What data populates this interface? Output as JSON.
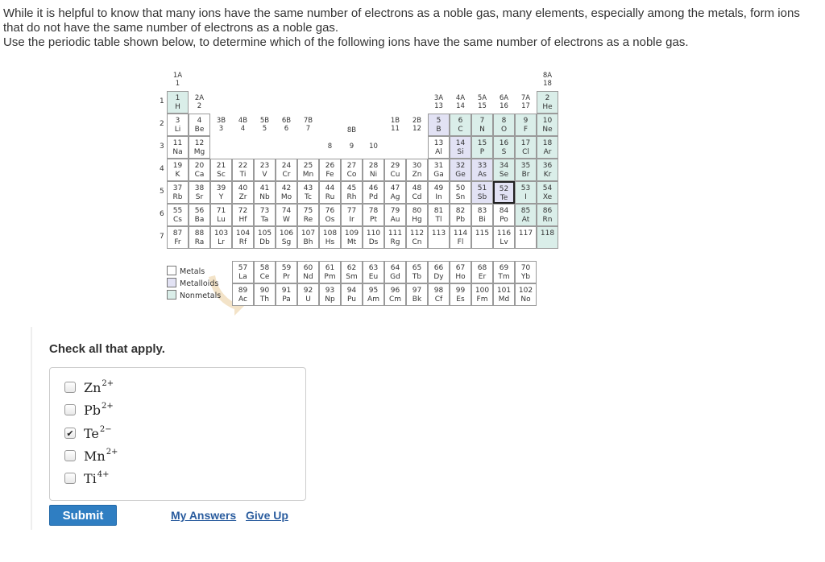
{
  "question": {
    "line1": "While it is helpful to know that many ions have the same number of electrons as a noble gas, many elements, especially among the metals, form ions that do not have the same number of electrons as a noble gas.",
    "line2": "Use the periodic table shown below, to determine which of the following ions have the same number of electrons as a noble gas."
  },
  "periodic_table": {
    "group_labels": {
      "1A": "1A",
      "1": "1",
      "2A": "2A",
      "2": "2",
      "3B": "3B",
      "3": "3",
      "4B": "4B",
      "4": "4",
      "5B": "5B",
      "5": "5",
      "6B": "6B",
      "6": "6",
      "7B": "7B",
      "7": "7",
      "8B": "8B",
      "8": "8",
      "9": "9",
      "10": "10",
      "1B": "1B",
      "11": "11",
      "2B": "2B",
      "12": "12",
      "3A": "3A",
      "13": "13",
      "4A": "4A",
      "14": "14",
      "5A": "5A",
      "15": "15",
      "6A": "6A",
      "16": "16",
      "7A": "7A",
      "17": "17",
      "8A": "8A",
      "18": "18"
    },
    "periods": [
      "1",
      "2",
      "3",
      "4",
      "5",
      "6",
      "7"
    ],
    "elements": [
      {
        "z": "1",
        "s": "H",
        "t": "non"
      },
      {
        "z": "2",
        "s": "He",
        "t": "non"
      },
      {
        "z": "3",
        "s": "Li",
        "t": "met"
      },
      {
        "z": "4",
        "s": "Be",
        "t": "met"
      },
      {
        "z": "5",
        "s": "B",
        "t": "mld"
      },
      {
        "z": "6",
        "s": "C",
        "t": "non"
      },
      {
        "z": "7",
        "s": "N",
        "t": "non"
      },
      {
        "z": "8",
        "s": "O",
        "t": "non"
      },
      {
        "z": "9",
        "s": "F",
        "t": "non"
      },
      {
        "z": "10",
        "s": "Ne",
        "t": "non"
      },
      {
        "z": "11",
        "s": "Na",
        "t": "met"
      },
      {
        "z": "12",
        "s": "Mg",
        "t": "met"
      },
      {
        "z": "13",
        "s": "Al",
        "t": "met"
      },
      {
        "z": "14",
        "s": "Si",
        "t": "mld"
      },
      {
        "z": "15",
        "s": "P",
        "t": "non"
      },
      {
        "z": "16",
        "s": "S",
        "t": "non"
      },
      {
        "z": "17",
        "s": "Cl",
        "t": "non"
      },
      {
        "z": "18",
        "s": "Ar",
        "t": "non"
      },
      {
        "z": "19",
        "s": "K",
        "t": "met"
      },
      {
        "z": "20",
        "s": "Ca",
        "t": "met"
      },
      {
        "z": "21",
        "s": "Sc",
        "t": "met"
      },
      {
        "z": "22",
        "s": "Ti",
        "t": "met"
      },
      {
        "z": "23",
        "s": "V",
        "t": "met"
      },
      {
        "z": "24",
        "s": "Cr",
        "t": "met"
      },
      {
        "z": "25",
        "s": "Mn",
        "t": "met"
      },
      {
        "z": "26",
        "s": "Fe",
        "t": "met"
      },
      {
        "z": "27",
        "s": "Co",
        "t": "met"
      },
      {
        "z": "28",
        "s": "Ni",
        "t": "met"
      },
      {
        "z": "29",
        "s": "Cu",
        "t": "met"
      },
      {
        "z": "30",
        "s": "Zn",
        "t": "met"
      },
      {
        "z": "31",
        "s": "Ga",
        "t": "met"
      },
      {
        "z": "32",
        "s": "Ge",
        "t": "mld"
      },
      {
        "z": "33",
        "s": "As",
        "t": "mld"
      },
      {
        "z": "34",
        "s": "Se",
        "t": "non"
      },
      {
        "z": "35",
        "s": "Br",
        "t": "non"
      },
      {
        "z": "36",
        "s": "Kr",
        "t": "non"
      },
      {
        "z": "37",
        "s": "Rb",
        "t": "met"
      },
      {
        "z": "38",
        "s": "Sr",
        "t": "met"
      },
      {
        "z": "39",
        "s": "Y",
        "t": "met"
      },
      {
        "z": "40",
        "s": "Zr",
        "t": "met"
      },
      {
        "z": "41",
        "s": "Nb",
        "t": "met"
      },
      {
        "z": "42",
        "s": "Mo",
        "t": "met"
      },
      {
        "z": "43",
        "s": "Tc",
        "t": "met"
      },
      {
        "z": "44",
        "s": "Ru",
        "t": "met"
      },
      {
        "z": "45",
        "s": "Rh",
        "t": "met"
      },
      {
        "z": "46",
        "s": "Pd",
        "t": "met"
      },
      {
        "z": "47",
        "s": "Ag",
        "t": "met"
      },
      {
        "z": "48",
        "s": "Cd",
        "t": "met"
      },
      {
        "z": "49",
        "s": "In",
        "t": "met"
      },
      {
        "z": "50",
        "s": "Sn",
        "t": "met"
      },
      {
        "z": "51",
        "s": "Sb",
        "t": "mld"
      },
      {
        "z": "52",
        "s": "Te",
        "t": "mld"
      },
      {
        "z": "53",
        "s": "I",
        "t": "non"
      },
      {
        "z": "54",
        "s": "Xe",
        "t": "non"
      },
      {
        "z": "55",
        "s": "Cs",
        "t": "met"
      },
      {
        "z": "56",
        "s": "Ba",
        "t": "met"
      },
      {
        "z": "71",
        "s": "Lu",
        "t": "met"
      },
      {
        "z": "72",
        "s": "Hf",
        "t": "met"
      },
      {
        "z": "73",
        "s": "Ta",
        "t": "met"
      },
      {
        "z": "74",
        "s": "W",
        "t": "met"
      },
      {
        "z": "75",
        "s": "Re",
        "t": "met"
      },
      {
        "z": "76",
        "s": "Os",
        "t": "met"
      },
      {
        "z": "77",
        "s": "Ir",
        "t": "met"
      },
      {
        "z": "78",
        "s": "Pt",
        "t": "met"
      },
      {
        "z": "79",
        "s": "Au",
        "t": "met"
      },
      {
        "z": "80",
        "s": "Hg",
        "t": "met"
      },
      {
        "z": "81",
        "s": "Tl",
        "t": "met"
      },
      {
        "z": "82",
        "s": "Pb",
        "t": "met"
      },
      {
        "z": "83",
        "s": "Bi",
        "t": "met"
      },
      {
        "z": "84",
        "s": "Po",
        "t": "met"
      },
      {
        "z": "85",
        "s": "At",
        "t": "non"
      },
      {
        "z": "86",
        "s": "Rn",
        "t": "non"
      },
      {
        "z": "87",
        "s": "Fr",
        "t": "met"
      },
      {
        "z": "88",
        "s": "Ra",
        "t": "met"
      },
      {
        "z": "103",
        "s": "Lr",
        "t": "met"
      },
      {
        "z": "104",
        "s": "Rf",
        "t": "met"
      },
      {
        "z": "105",
        "s": "Db",
        "t": "met"
      },
      {
        "z": "106",
        "s": "Sg",
        "t": "met"
      },
      {
        "z": "107",
        "s": "Bh",
        "t": "met"
      },
      {
        "z": "108",
        "s": "Hs",
        "t": "met"
      },
      {
        "z": "109",
        "s": "Mt",
        "t": "met"
      },
      {
        "z": "110",
        "s": "Ds",
        "t": "met"
      },
      {
        "z": "111",
        "s": "Rg",
        "t": "met"
      },
      {
        "z": "112",
        "s": "Cn",
        "t": "met"
      },
      {
        "z": "113",
        "s": "",
        "t": "met"
      },
      {
        "z": "114",
        "s": "Fl",
        "t": "met"
      },
      {
        "z": "115",
        "s": "",
        "t": "met"
      },
      {
        "z": "116",
        "s": "Lv",
        "t": "met"
      },
      {
        "z": "117",
        "s": "",
        "t": "met"
      },
      {
        "z": "118",
        "s": "",
        "t": "non"
      },
      {
        "z": "57",
        "s": "La",
        "t": "met"
      },
      {
        "z": "58",
        "s": "Ce",
        "t": "met"
      },
      {
        "z": "59",
        "s": "Pr",
        "t": "met"
      },
      {
        "z": "60",
        "s": "Nd",
        "t": "met"
      },
      {
        "z": "61",
        "s": "Pm",
        "t": "met"
      },
      {
        "z": "62",
        "s": "Sm",
        "t": "met"
      },
      {
        "z": "63",
        "s": "Eu",
        "t": "met"
      },
      {
        "z": "64",
        "s": "Gd",
        "t": "met"
      },
      {
        "z": "65",
        "s": "Tb",
        "t": "met"
      },
      {
        "z": "66",
        "s": "Dy",
        "t": "met"
      },
      {
        "z": "67",
        "s": "Ho",
        "t": "met"
      },
      {
        "z": "68",
        "s": "Er",
        "t": "met"
      },
      {
        "z": "69",
        "s": "Tm",
        "t": "met"
      },
      {
        "z": "70",
        "s": "Yb",
        "t": "met"
      },
      {
        "z": "89",
        "s": "Ac",
        "t": "met"
      },
      {
        "z": "90",
        "s": "Th",
        "t": "met"
      },
      {
        "z": "91",
        "s": "Pa",
        "t": "met"
      },
      {
        "z": "92",
        "s": "U",
        "t": "met"
      },
      {
        "z": "93",
        "s": "Np",
        "t": "met"
      },
      {
        "z": "94",
        "s": "Pu",
        "t": "met"
      },
      {
        "z": "95",
        "s": "Am",
        "t": "met"
      },
      {
        "z": "96",
        "s": "Cm",
        "t": "met"
      },
      {
        "z": "97",
        "s": "Bk",
        "t": "met"
      },
      {
        "z": "98",
        "s": "Cf",
        "t": "met"
      },
      {
        "z": "99",
        "s": "Es",
        "t": "met"
      },
      {
        "z": "100",
        "s": "Fm",
        "t": "met"
      },
      {
        "z": "101",
        "s": "Md",
        "t": "met"
      },
      {
        "z": "102",
        "s": "No",
        "t": "met"
      }
    ],
    "legend": {
      "metals": "Metals",
      "metalloids": "Metalloids",
      "nonmetals": "Nonmetals"
    },
    "colors": {
      "metal": "#ffffff",
      "metalloid": "#e2e2f4",
      "nonmetal": "#daeee9",
      "arrow": "#f3e3c8"
    }
  },
  "check": {
    "title": "Check all that apply.",
    "options": [
      {
        "base": "Zn",
        "charge": "2+",
        "checked": false
      },
      {
        "base": "Pb",
        "charge": "2+",
        "checked": false
      },
      {
        "base": "Te",
        "charge": "2−",
        "checked": true
      },
      {
        "base": "Mn",
        "charge": "2+",
        "checked": false
      },
      {
        "base": "Ti",
        "charge": "4+",
        "checked": false
      }
    ]
  },
  "actions": {
    "submit": "Submit",
    "my_answers": "My Answers",
    "give_up": "Give Up"
  }
}
